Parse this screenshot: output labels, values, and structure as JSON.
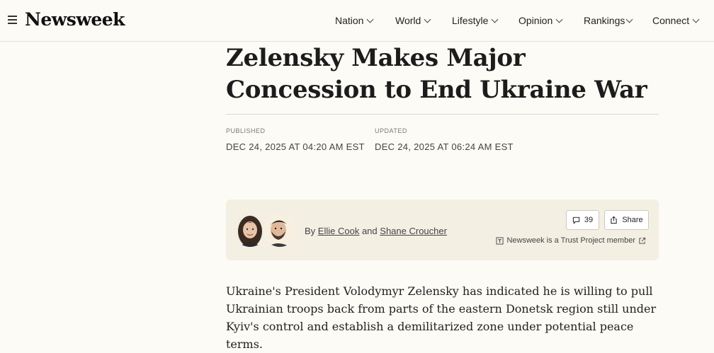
{
  "header": {
    "logo": "Newsweek",
    "nav": [
      {
        "label": "Nation"
      },
      {
        "label": "World"
      },
      {
        "label": "Lifestyle"
      },
      {
        "label": "Opinion"
      },
      {
        "label": "Rankings"
      },
      {
        "label": "Connect"
      }
    ]
  },
  "article": {
    "headline": "Zelensky Makes Major Concession to End Ukraine War",
    "published_label": "PUBLISHED",
    "published_date": "DEC 24, 2025 AT 04:20 AM EST",
    "updated_label": "UPDATED",
    "updated_date": "DEC 24, 2025 AT 06:24 AM EST",
    "byline": {
      "prefix": "By",
      "author1": "Ellie Cook",
      "conjunction": "and",
      "author2": "Shane Croucher"
    },
    "comment_count": "39",
    "share_label": "Share",
    "trust_text": "Newsweek is a Trust Project member",
    "lede": "Ukraine's President Volodymyr Zelensky has indicated he is willing to pull Ukrainian troops back from parts of the eastern Donetsk region still under Kyiv's control and establish a demilitarized zone under potential peace terms."
  },
  "colors": {
    "background": "#fdfbf5",
    "byline_box": "#f4efe3",
    "text": "#1a1a1a"
  }
}
